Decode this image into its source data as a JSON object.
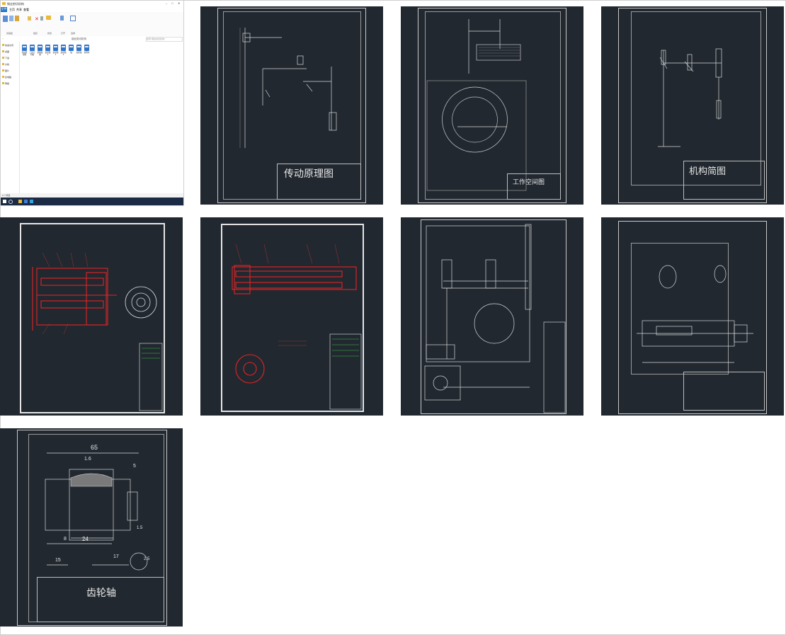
{
  "explorer": {
    "title": "钢丝剪切机构",
    "tabs": [
      "文件",
      "主页",
      "共享",
      "查看"
    ],
    "ribbon_groups": [
      "剪贴板",
      "组织",
      "新建",
      "打开",
      "选择"
    ],
    "path": "钢丝剪切机构",
    "search_placeholder": "搜索\"钢丝剪切机构\"",
    "nav_items": [
      "快速访问",
      "桌面",
      "下载",
      "文档",
      "图片",
      "此电脑",
      "网络"
    ],
    "files": [
      "传动原理图",
      "工作空间图",
      "机构简图",
      "装配图1",
      "装配图2",
      "装配图3",
      "轴",
      "齿轮轴",
      "说明书"
    ],
    "status": "9 个项目"
  },
  "drawings": {
    "transmission": {
      "title": "传动原理图"
    },
    "workspace": {
      "title": "工作空间图"
    },
    "mechanism": {
      "title": "机构简图"
    },
    "gearshaft": {
      "title": "齿轮轴",
      "dims": [
        "65",
        "1.6",
        "5",
        "24",
        "8",
        "15",
        "17",
        "1.5",
        "2.5"
      ]
    }
  }
}
